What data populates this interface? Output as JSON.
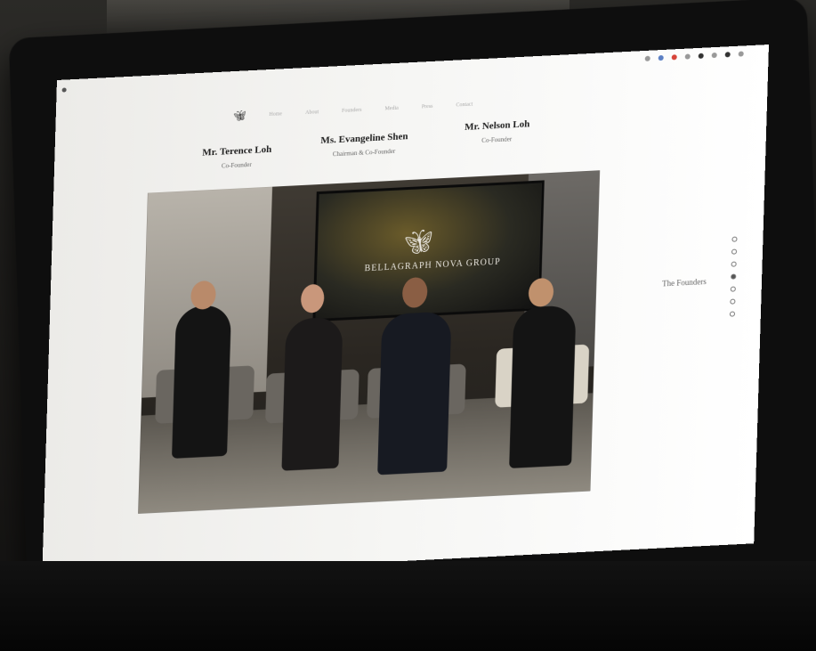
{
  "browser": {
    "tab_label": "",
    "url": ""
  },
  "site": {
    "nav_items": [
      "Home",
      "About",
      "Founders",
      "Media",
      "Press",
      "Contact"
    ]
  },
  "founders": [
    {
      "name": "Mr. Terence Loh",
      "role": "Co-Founder"
    },
    {
      "name": "Ms. Evangeline Shen",
      "role": "Chairman & Co-Founder"
    },
    {
      "name": "Mr. Nelson Loh",
      "role": "Co-Founder"
    }
  ],
  "photo": {
    "brand_text": "BELLAGRAPH NOVA GROUP"
  },
  "section": {
    "label": "The Founders",
    "pager_count": 7,
    "active_index": 3
  },
  "colors": {
    "screen_bg": "#f2f2f0",
    "text_dark": "#1e1e1e",
    "text_muted": "#666666"
  }
}
